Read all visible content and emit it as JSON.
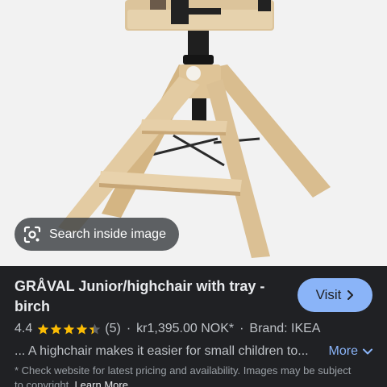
{
  "lens": {
    "label": "Search inside image",
    "icon": "lens-camera-icon"
  },
  "product": {
    "title": "GRÅVAL Junior/highchair with tray - birch",
    "rating": "4.4",
    "rating_value": 4.4,
    "rating_max": 5,
    "review_count": "(5)",
    "price": "kr1,395.00 NOK*",
    "brand": "Brand: IKEA",
    "description": "... A highchair makes it easier for small children to...",
    "more_label": "More",
    "disclaimer": "* Check website for latest pricing and availability. Images may be subject to copyright.",
    "learn_more_label": "Learn More"
  },
  "visit_button": {
    "label": "Visit"
  },
  "colors": {
    "panel_bg": "#202124",
    "accent": "#8ab4f8",
    "star": "#fbbc04",
    "text_primary": "#e8eaed",
    "text_secondary": "#bdc1c6"
  }
}
